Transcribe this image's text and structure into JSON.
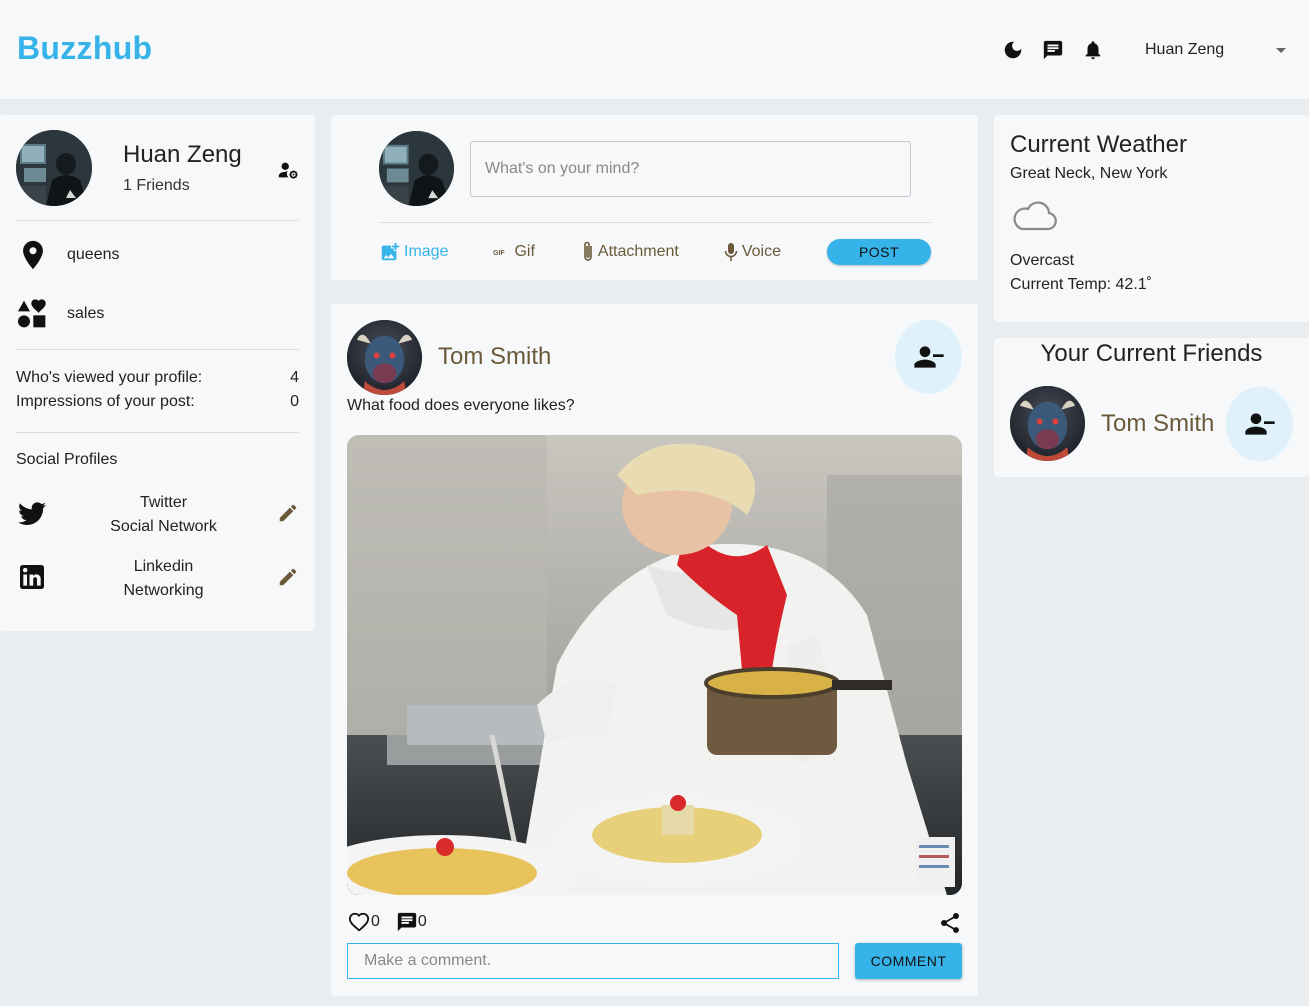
{
  "header": {
    "logo": "Buzzhub",
    "user_name": "Huan Zeng",
    "icons": [
      "dark-mode-icon",
      "chat-icon",
      "notifications-icon",
      "dropdown-arrow-icon"
    ]
  },
  "profile": {
    "name": "Huan Zeng",
    "friends": "1 Friends",
    "location": "queens",
    "occupation": "sales",
    "viewed_label": "Who's viewed your profile:",
    "viewed_value": "4",
    "impressions_label": "Impressions of your post:",
    "impressions_value": "0",
    "social_title": "Social Profiles",
    "socials": [
      {
        "name": "Twitter",
        "desc": "Social Network"
      },
      {
        "name": "Linkedin",
        "desc": "Networking"
      }
    ]
  },
  "compose": {
    "placeholder": "What's on your mind?",
    "actions": {
      "image": "Image",
      "gif": "Gif",
      "attachment": "Attachment",
      "voice": "Voice"
    },
    "post_label": "POST"
  },
  "post": {
    "author": "Tom Smith",
    "text": "What food does everyone likes?",
    "likes": "0",
    "comments": "0",
    "comment_placeholder": "Make a comment.",
    "comment_label": "COMMENT"
  },
  "weather": {
    "title": "Current Weather",
    "location": "Great Neck, New York",
    "condition": "Overcast",
    "temp": "Current Temp: 42.1˚"
  },
  "friends": {
    "title": "Your Current Friends",
    "items": [
      {
        "name": "Tom Smith"
      }
    ]
  },
  "colors": {
    "accent": "#36b3e8",
    "author": "#6b5a3a",
    "background": "#e9edf0",
    "card": "#f6f8fa"
  }
}
